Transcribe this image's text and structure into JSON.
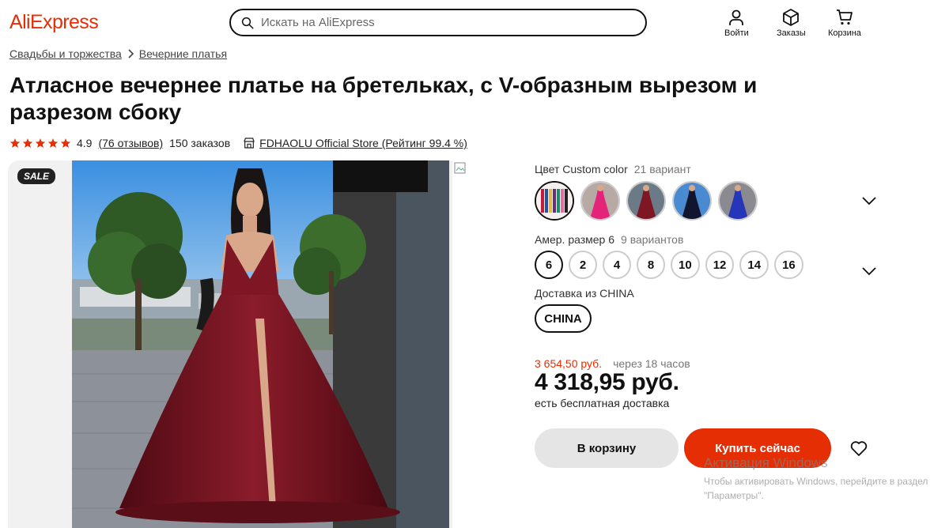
{
  "header": {
    "logo": "AliExpress",
    "search_placeholder": "Искать на AliExpress",
    "login_label": "Войти",
    "orders_label": "Заказы",
    "cart_label": "Корзина",
    "brand_color": "#e62e04"
  },
  "breadcrumb": [
    "Свадьбы и торжества",
    "Вечерние платья"
  ],
  "product": {
    "title": "Атласное вечернее платье на бретельках, с V-образным вырезом и разрезом сбоку",
    "rating": "4.9",
    "reviews": "(76 отзывов)",
    "orders": "150 заказов",
    "store": "FDHAOLU Official Store (Рейтинг 99.4 %)",
    "sale_badge": "SALE"
  },
  "options": {
    "color_label": "Цвет Custom color",
    "color_count": "21 вариант",
    "color_swatches": [
      "swatch-palette",
      "swatch-pink",
      "swatch-burgundy",
      "swatch-navy",
      "swatch-royal-blue"
    ],
    "size_label": "Амер. размер 6",
    "size_count": "9 вариантов",
    "sizes": [
      "6",
      "2",
      "4",
      "8",
      "10",
      "12",
      "14",
      "16"
    ],
    "shipping_label": "Доставка из CHINA",
    "shipping_option": "CHINA"
  },
  "pricing": {
    "old_price": "3 654,50 руб.",
    "old_price_note": "через 18 часов",
    "price": "4 318,95 руб.",
    "delivery": "есть бесплатная доставка"
  },
  "actions": {
    "add_to_cart": "В корзину",
    "buy_now": "Купить сейчас"
  },
  "watermark": {
    "line1": "Активация Windows",
    "line2": "Чтобы активировать Windows, перейдите в раздел \"Параметры\"."
  }
}
